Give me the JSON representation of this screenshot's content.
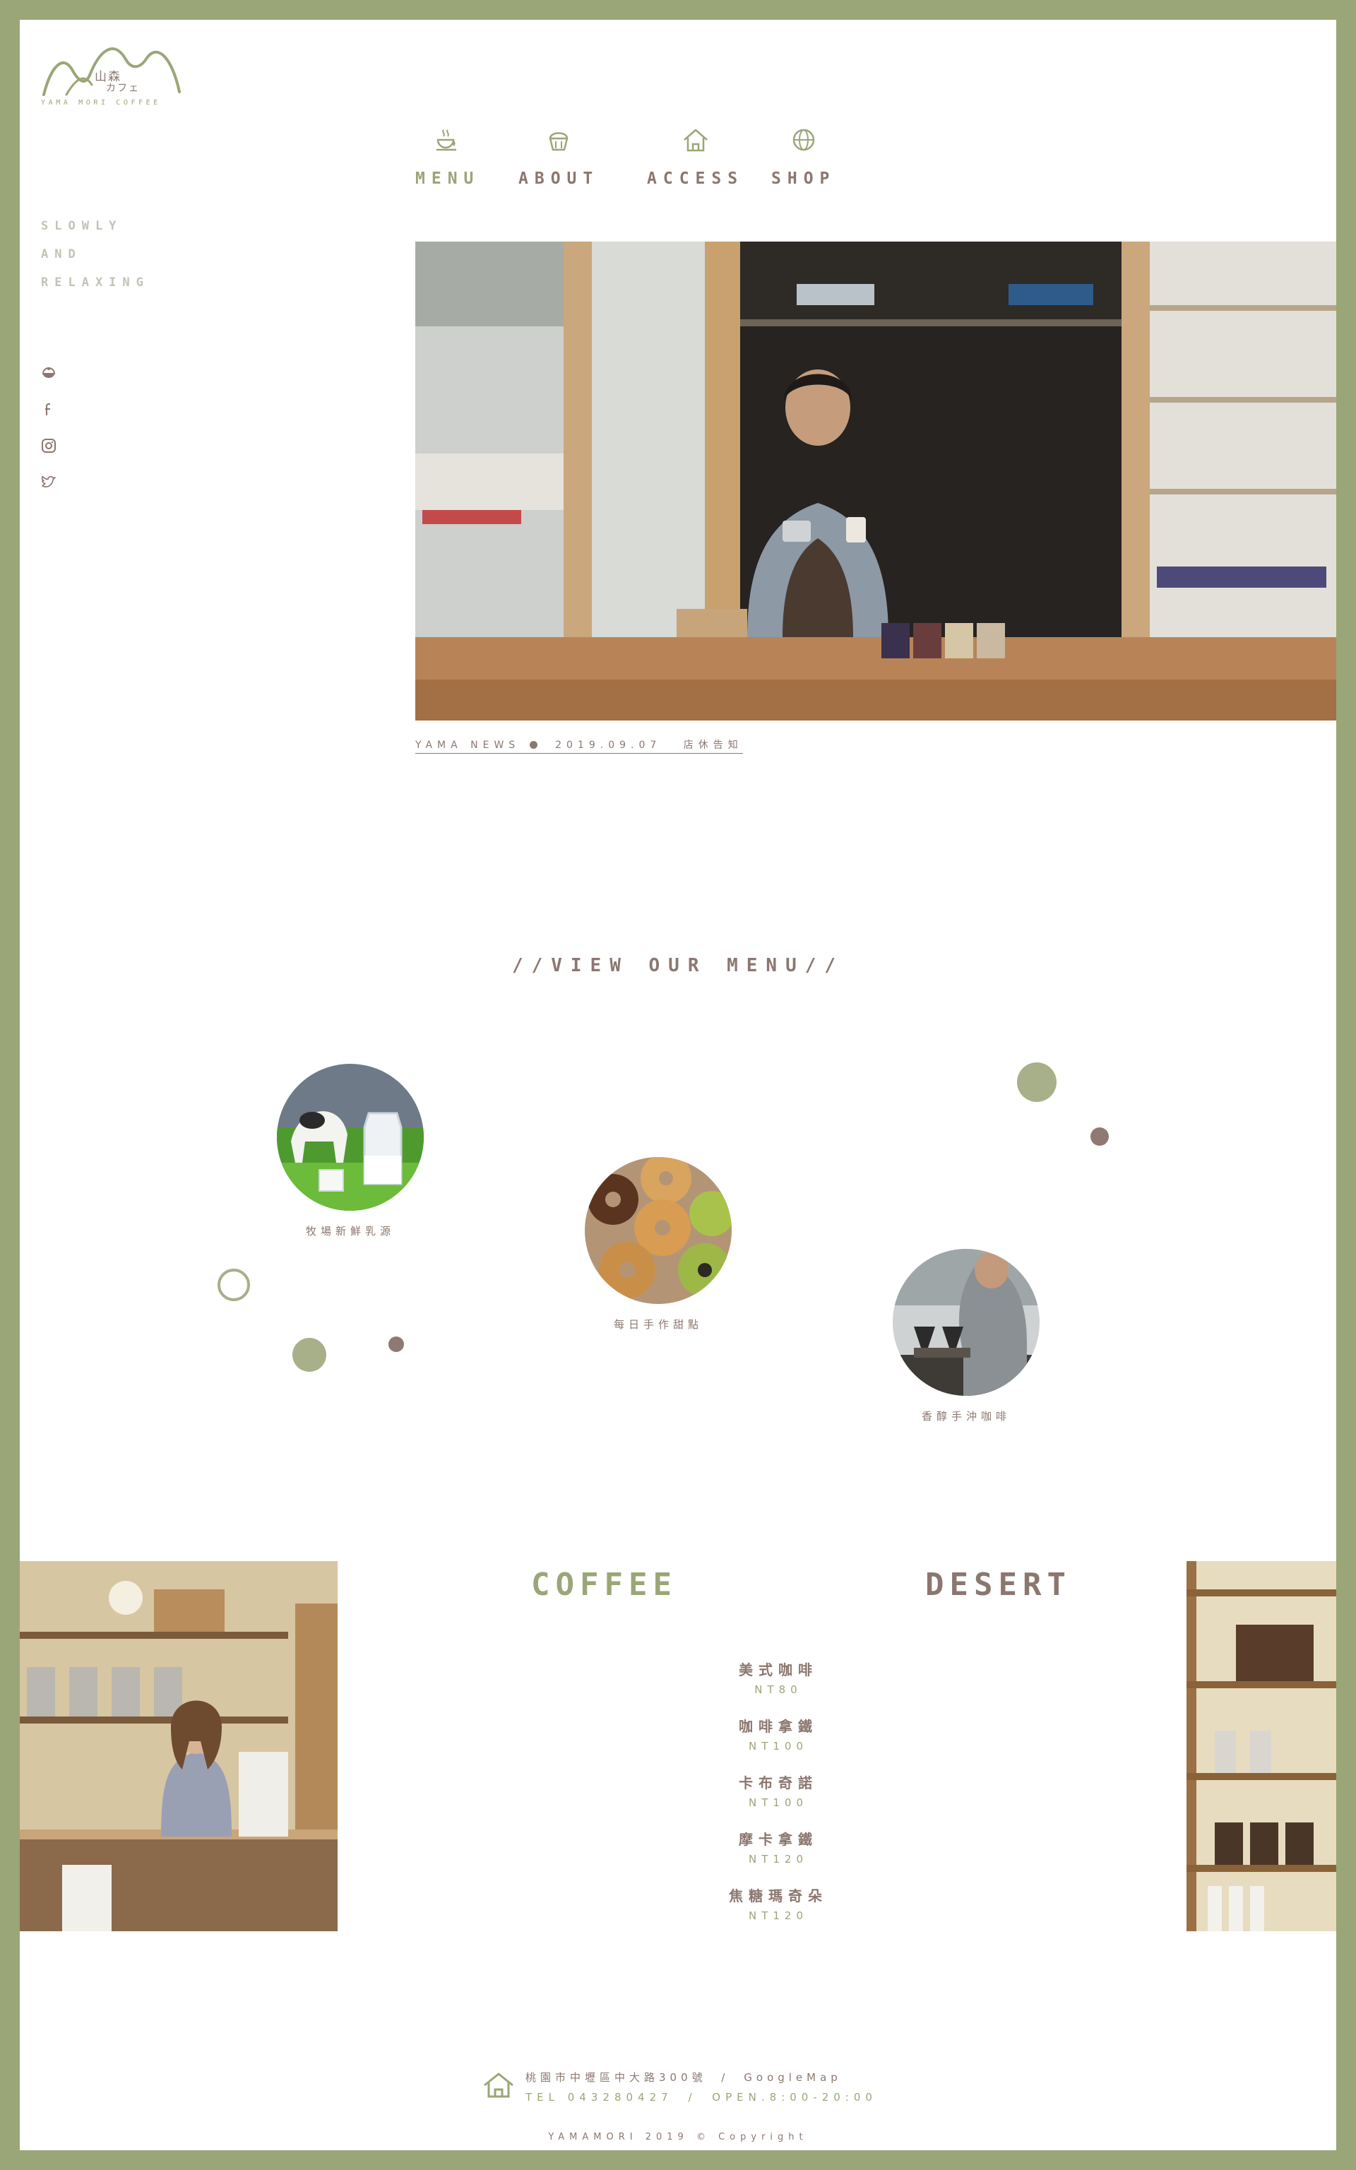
{
  "brand": {
    "logo_kanji": "山森",
    "logo_kana": "カフェ",
    "logo_name": "YAMA MORI COFFEE"
  },
  "tagline": [
    "SLOWLY",
    "AND",
    "RELAXING"
  ],
  "social": [
    "coffee-bean-icon",
    "facebook-icon",
    "instagram-icon",
    "twitter-icon"
  ],
  "nav": [
    {
      "label": "MENU",
      "icon": "coffee-cup-icon"
    },
    {
      "label": "ABOUT",
      "icon": "muffin-icon"
    },
    {
      "label": "ACCESS",
      "icon": "house-icon"
    },
    {
      "label": "SHOP",
      "icon": "globe-icon"
    }
  ],
  "news": {
    "label": "YAMA NEWS",
    "date": "2019.09.07",
    "title": "店休告知"
  },
  "view_menu": {
    "title": "//VIEW OUR MENU//",
    "items": [
      {
        "caption": "牧場新鮮乳源"
      },
      {
        "caption": "每日手作甜點"
      },
      {
        "caption": "香醇手沖咖啡"
      }
    ]
  },
  "categories": {
    "coffee": "COFFEE",
    "desert": "DESERT"
  },
  "coffee_menu": [
    {
      "name": "美式咖啡",
      "price": "NT80"
    },
    {
      "name": "咖啡拿鐵",
      "price": "NT100"
    },
    {
      "name": "卡布奇諾",
      "price": "NT100"
    },
    {
      "name": "摩卡拿鐵",
      "price": "NT120"
    },
    {
      "name": "焦糖瑪奇朵",
      "price": "NT120"
    }
  ],
  "footer": {
    "address": "桃園市中壢區中大路300號",
    "separator": "/",
    "map_link": "GoogleMap",
    "tel": "TEL 043280427",
    "hours": "OPEN.8:00-20:00",
    "copyright": "YAMAMORI 2019 © Copyright"
  },
  "colors": {
    "green": "#9aa677",
    "brown": "#8b7770",
    "frame": "#9aa677"
  }
}
